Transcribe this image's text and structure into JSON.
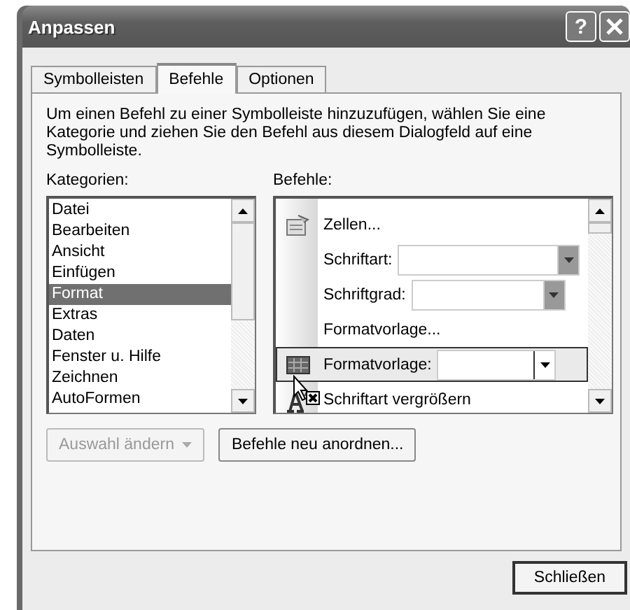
{
  "window": {
    "title": "Anpassen",
    "help_button": "?"
  },
  "tabs": [
    {
      "label": "Symbolleisten",
      "selected": false
    },
    {
      "label": "Befehle",
      "selected": true
    },
    {
      "label": "Optionen",
      "selected": false
    }
  ],
  "description": "Um einen Befehl zu einer Symbolleiste hinzuzufügen, wählen Sie eine Kategorie und ziehen Sie den Befehl aus diesem Dialogfeld auf eine Symbolleiste.",
  "categories": {
    "label": "Kategorien:",
    "items": [
      {
        "label": "Datei",
        "selected": false
      },
      {
        "label": "Bearbeiten",
        "selected": false
      },
      {
        "label": "Ansicht",
        "selected": false
      },
      {
        "label": "Einfügen",
        "selected": false
      },
      {
        "label": "Format",
        "selected": true
      },
      {
        "label": "Extras",
        "selected": false
      },
      {
        "label": "Daten",
        "selected": false
      },
      {
        "label": "Fenster u. Hilfe",
        "selected": false
      },
      {
        "label": "Zeichnen",
        "selected": false
      },
      {
        "label": "AutoFormen",
        "selected": false
      }
    ]
  },
  "commands": {
    "label": "Befehle:",
    "items": [
      {
        "kind": "command",
        "label": "Zellen...",
        "selected": false
      },
      {
        "kind": "combo",
        "label": "Schriftart:",
        "selected": false
      },
      {
        "kind": "combo",
        "label": "Schriftgrad:",
        "selected": false
      },
      {
        "kind": "command",
        "label": "Formatvorlage...",
        "selected": false
      },
      {
        "kind": "combo",
        "label": "Formatvorlage:",
        "selected": true
      },
      {
        "kind": "command",
        "label": "Schriftart vergrößern",
        "selected": false
      }
    ]
  },
  "buttons": [
    {
      "label": "Auswahl ändern",
      "disabled": true,
      "dropdown": true
    },
    {
      "label": "Befehle neu anordnen...",
      "disabled": false,
      "dropdown": false
    }
  ],
  "close_button": {
    "label": "Schließen"
  }
}
